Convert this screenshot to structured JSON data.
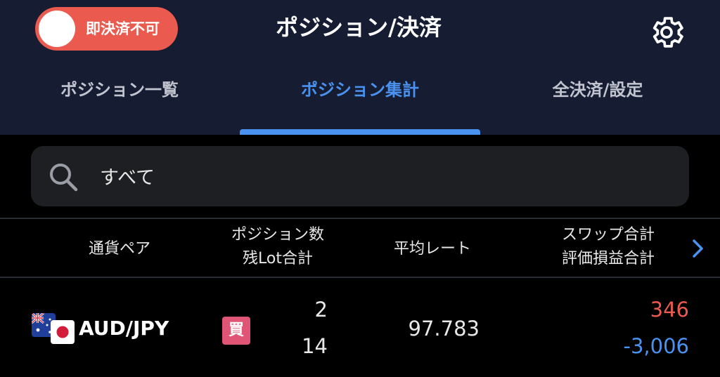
{
  "header": {
    "toggle_label": "即決済不可",
    "toggle_on": false,
    "title": "ポジション/決済",
    "settings_icon": "gear-icon"
  },
  "tabs": [
    {
      "label": "ポジション一覧",
      "active": false
    },
    {
      "label": "ポジション集計",
      "active": true
    },
    {
      "label": "全決済/設定",
      "active": false
    }
  ],
  "search": {
    "value": "すべて",
    "icon": "search-icon"
  },
  "table": {
    "headers": {
      "pair": "通貨ペア",
      "count_line1": "ポジション数",
      "count_line2": "残Lot合計",
      "rate": "平均レート",
      "pl_line1": "スワップ合計",
      "pl_line2": "評価損益合計"
    },
    "rows": [
      {
        "pair": "AUD/JPY",
        "side": "買",
        "positions": "2",
        "lots": "14",
        "avg_rate": "97.783",
        "swap_total": "346",
        "pl_total": "-3,006"
      }
    ]
  },
  "colors": {
    "header_bg": "#161d33",
    "accent": "#4a92f0",
    "toggle": "#ea5a4f",
    "buy": "#e05575",
    "positive": "#ea5a4f",
    "negative": "#4a92f0"
  }
}
